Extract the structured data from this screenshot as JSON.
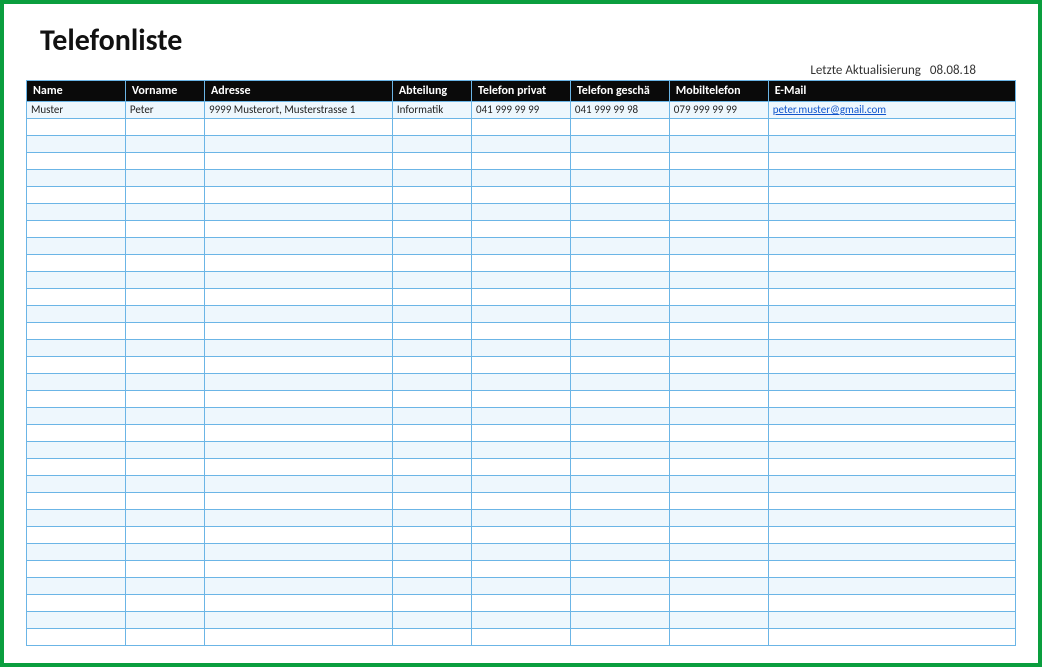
{
  "title": "Telefonliste",
  "lastUpdated": {
    "label": "Letzte Aktualisierung",
    "date": "08.08.18"
  },
  "columns": {
    "name": "Name",
    "vorname": "Vorname",
    "adresse": "Adresse",
    "abteilung": "Abteilung",
    "telPrivat": "Telefon privat",
    "telGeschaeft": "Telefon geschä",
    "mobil": "Mobiltelefon",
    "email": "E-Mail"
  },
  "rows": [
    {
      "name": "Muster",
      "vorname": "Peter",
      "adresse": "9999 Musterort, Musterstrasse 1",
      "abteilung": "Informatik",
      "telPrivat": "041 999 99 99",
      "telGeschaeft": "041 999 99 98",
      "mobil": "079 999 99 99",
      "email": "peter.muster@gmail.com"
    }
  ],
  "emptyRowCount": 31
}
